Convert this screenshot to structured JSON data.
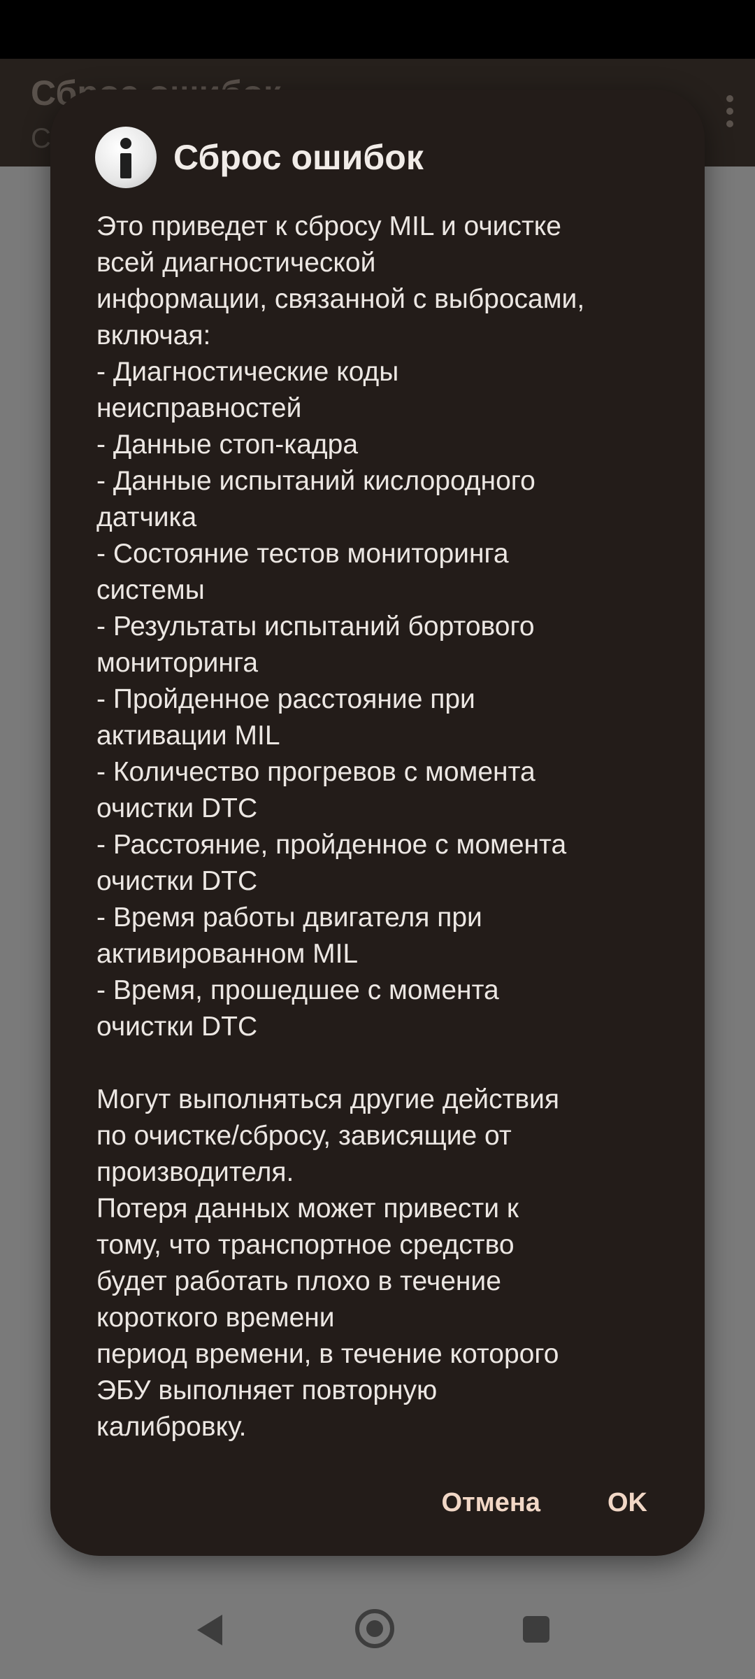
{
  "app_bar": {
    "title": "Сброс ошибок",
    "subtitle": "С"
  },
  "dialog": {
    "icon": "info-icon",
    "title": "Сброс ошибок",
    "message": "Это приведет к сбросу MIL и очистке\nвсей диагностической\nинформации, связанной с выбросами,\nвключая:\n- Диагностические коды\nнеисправностей\n- Данные стоп-кадра\n- Данные испытаний кислородного\nдатчика\n- Состояние тестов мониторинга\nсистемы\n- Результаты испытаний бортового\nмониторинга\n- Пройденное расстояние при\nактивации MIL\n- Количество прогревов с момента\nочистки DTC\n- Расстояние, пройденное с момента\nочистки DTC\n- Время работы двигателя при\nактивированном MIL\n- Время, прошедшее с момента\nочистки DTC\n\nМогут выполняться другие действия\nпо очистке/сбросу, зависящие от\nпроизводителя.\nПотеря данных может привести к\nтому, что транспортное средство\nбудет работать плохо в течение\nкороткого времени\nпериод времени, в течение которого\nЭБУ выполняет повторную\nкалибровку.",
    "cancel_label": "Отмена",
    "ok_label": "OK"
  },
  "colors": {
    "dialog_background": "#231c19",
    "accent_button_text": "#f1d7c6",
    "scrim": "#7a7a7a"
  }
}
